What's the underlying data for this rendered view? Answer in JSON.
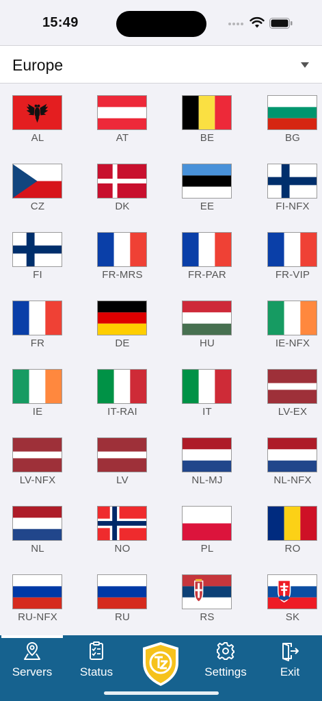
{
  "status": {
    "time": "15:49"
  },
  "selector": {
    "value": "Europe"
  },
  "flags": [
    {
      "code": "AL"
    },
    {
      "code": "AT"
    },
    {
      "code": "BE"
    },
    {
      "code": "BG"
    },
    {
      "code": "CZ"
    },
    {
      "code": "DK"
    },
    {
      "code": "EE"
    },
    {
      "code": "FI-NFX"
    },
    {
      "code": "FI"
    },
    {
      "code": "FR-MRS"
    },
    {
      "code": "FR-PAR"
    },
    {
      "code": "FR-VIP"
    },
    {
      "code": "FR"
    },
    {
      "code": "DE"
    },
    {
      "code": "HU"
    },
    {
      "code": "IE-NFX"
    },
    {
      "code": "IE"
    },
    {
      "code": "IT-RAI"
    },
    {
      "code": "IT"
    },
    {
      "code": "LV-EX"
    },
    {
      "code": "LV-NFX"
    },
    {
      "code": "LV"
    },
    {
      "code": "NL-MJ"
    },
    {
      "code": "NL-NFX"
    },
    {
      "code": "NL"
    },
    {
      "code": "NO"
    },
    {
      "code": "PL"
    },
    {
      "code": "RO"
    },
    {
      "code": "RU-NFX"
    },
    {
      "code": "RU"
    },
    {
      "code": "RS"
    },
    {
      "code": "SK"
    }
  ],
  "tabs": {
    "servers": "Servers",
    "status": "Status",
    "settings": "Settings",
    "exit": "Exit"
  },
  "colors": {
    "tabbar": "#16628f",
    "background": "#f2f2f7",
    "shield": "#f6c21c"
  }
}
